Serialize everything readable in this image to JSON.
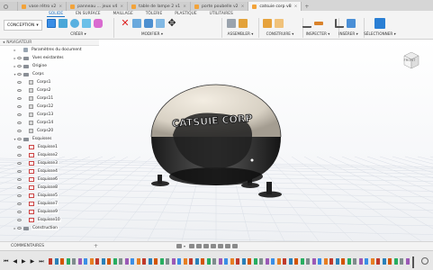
{
  "tabs": [
    {
      "label": ""
    },
    {
      "label": "vase rétro v2",
      "close": "×"
    },
    {
      "label": "panneau ... jeux v4",
      "close": "×"
    },
    {
      "label": "table de lampe 2 v1",
      "close": "×"
    },
    {
      "label": "porte poubelle v2",
      "close": "×"
    },
    {
      "label": "catsuie corp v8",
      "close": "×",
      "active": true
    }
  ],
  "tab_add": "+",
  "workspace": {
    "label": "CONCEPTION",
    "caret": "▾"
  },
  "mode_tabs": [
    "SOLIDE",
    "EN SURFACE",
    "MAILLAGE",
    "TÔLERIE",
    "PLASTIQUE",
    "UTILITAIRES"
  ],
  "groups": {
    "create": "CRÉER ▾",
    "modify": "MODIFIER ▾",
    "assemble": "ASSEMBLER ▾",
    "construct": "CONSTRUIRE ▾",
    "inspect": "INSPECTER ▾",
    "insert": "INSÉRER ▾",
    "select": "SÉLECTIONNER ▾"
  },
  "browser": {
    "title": "NAVIGATEUR",
    "items": [
      {
        "label": "Paramètres du document",
        "kind": "doc"
      },
      {
        "label": "Vues existantes",
        "kind": "folder"
      },
      {
        "label": "Origine",
        "kind": "folder"
      },
      {
        "label": "Corps",
        "kind": "folder"
      },
      {
        "label": "Corps1",
        "kind": "body"
      },
      {
        "label": "Corps2",
        "kind": "body"
      },
      {
        "label": "Corps11",
        "kind": "body"
      },
      {
        "label": "Corps12",
        "kind": "body"
      },
      {
        "label": "Corps13",
        "kind": "body"
      },
      {
        "label": "Corps14",
        "kind": "body"
      },
      {
        "label": "Corps20",
        "kind": "body"
      },
      {
        "label": "Esquisses",
        "kind": "folder"
      },
      {
        "label": "Esquisse1",
        "kind": "sketch"
      },
      {
        "label": "Esquisse2",
        "kind": "sketch"
      },
      {
        "label": "Esquisse3",
        "kind": "sketch"
      },
      {
        "label": "Esquisse4",
        "kind": "sketch"
      },
      {
        "label": "Esquisse6",
        "kind": "sketch"
      },
      {
        "label": "Esquisse8",
        "kind": "sketch"
      },
      {
        "label": "Esquisse5",
        "kind": "sketch"
      },
      {
        "label": "Esquisse7",
        "kind": "sketch"
      },
      {
        "label": "Esquisse9",
        "kind": "sketch"
      },
      {
        "label": "Esquisse10",
        "kind": "sketch"
      },
      {
        "label": "Construction",
        "kind": "folder"
      }
    ]
  },
  "model": {
    "decal_text": "CATSUIE CORP"
  },
  "viewcube": {
    "label": "FRONT"
  },
  "comments": {
    "label": "COMMENTAIRES",
    "add": "+"
  },
  "playback": {
    "first": "⏮",
    "prev": "◀",
    "play": "▶",
    "next": "▶",
    "last": "⏭"
  },
  "colors": {
    "accent": "#1a6fc4",
    "toolbar": "#f4f4f4",
    "timeline": "#e7e7e7"
  }
}
